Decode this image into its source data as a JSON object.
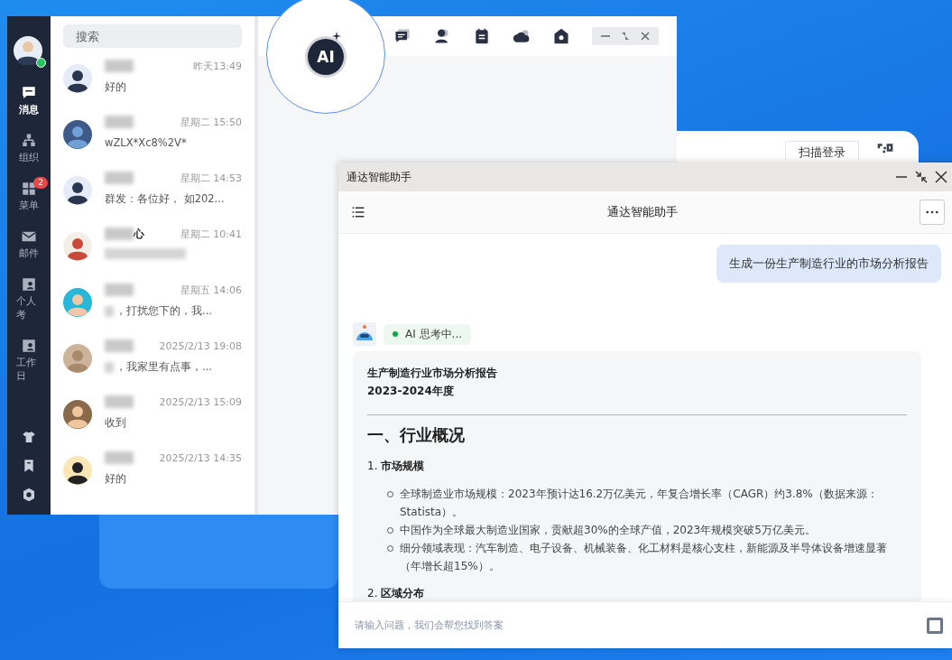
{
  "login_window": {
    "scan_login_button": "扫描登录"
  },
  "im_window": {
    "nav": [
      {
        "label": "消息",
        "selected": true
      },
      {
        "label": "组织",
        "selected": false
      },
      {
        "label": "菜单",
        "selected": false,
        "badge": "2"
      },
      {
        "label": "邮件",
        "selected": false
      },
      {
        "label": "个人考",
        "selected": false
      },
      {
        "label": "工作日",
        "selected": false
      }
    ],
    "search": {
      "placeholder": "搜索"
    },
    "chats": [
      {
        "time": "昨天13:49",
        "message": "好的"
      },
      {
        "time": "星期二 15:50",
        "message": "wZLX*Xc8%2V*"
      },
      {
        "time": "星期二 14:53",
        "message": "群发：各位好， 如202..."
      },
      {
        "name": "心",
        "time": "星期二 10:41"
      },
      {
        "time": "星期五 14:06",
        "message": "，打扰您下的，我..."
      },
      {
        "time": "2025/2/13 19:08",
        "message": "，我家里有点事，..."
      },
      {
        "time": "2025/2/13 15:09",
        "message": "收到"
      },
      {
        "time": "2025/2/13 14:35",
        "message": "好的"
      }
    ],
    "ai_logo": "AI"
  },
  "assistant_window": {
    "title": "通达智能助手",
    "header_title": "通达智能助手",
    "user_message": "生成一份生产制造行业的市场分析报告",
    "status": "AI 思考中...",
    "report": {
      "title_lines": [
        "生产制造行业市场分析报告",
        "2023-2024年度"
      ],
      "heading": "一、行业概况",
      "sections": [
        {
          "title": "1. **市场规模**",
          "bullets": [
            "全球制造业市场规模：2023年预计达16.2万亿美元，年复合增长率（CAGR）约3.8%（数据来源：Statista）。",
            "中国作为全球最大制造业国家，贡献超30%的全球产值，2023年规模突破5万亿美元。",
            "细分领域表现：汽车制造、电子设备、机械装备、化工材料是核心支柱，新能源及半导体设备增速显著（年增长超15%）。"
          ]
        },
        {
          "title": "2. **区域分布**"
        }
      ]
    },
    "input": {
      "placeholder": "请输入问题，我们会帮您找到答案"
    }
  }
}
